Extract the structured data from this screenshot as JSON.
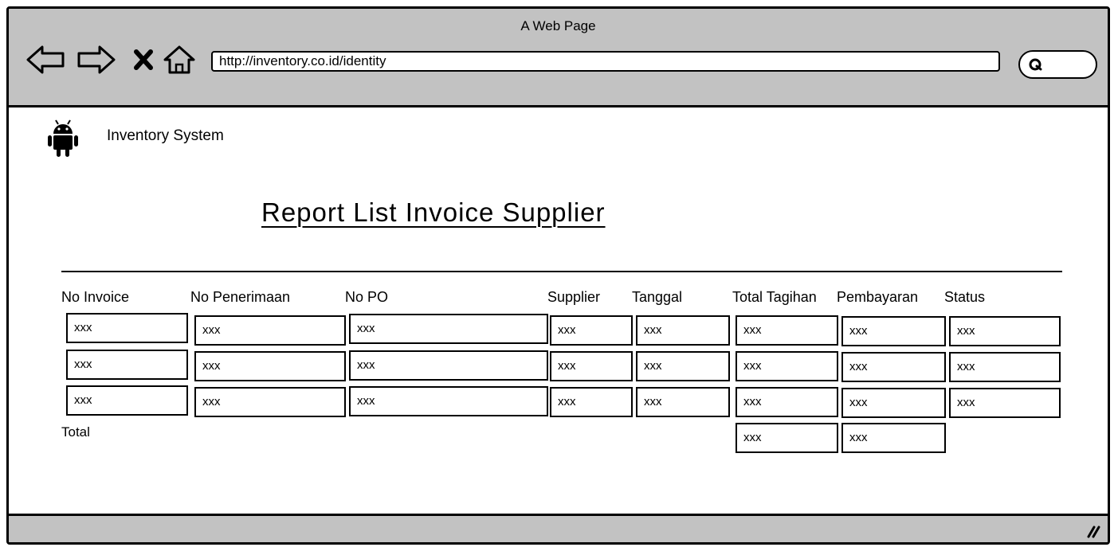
{
  "browser": {
    "window_title": "A Web Page",
    "url": "http://inventory.co.id/identity"
  },
  "app": {
    "name": "Inventory System",
    "logo_icon": "android-icon"
  },
  "report": {
    "title": "Report List Invoice Supplier",
    "columns": [
      "No Invoice",
      "No Penerimaan",
      "No PO",
      "Supplier",
      "Tanggal",
      "Total Tagihan",
      "Pembayaran",
      "Status"
    ],
    "rows": [
      [
        "xxx",
        "xxx",
        "xxx",
        "xxx",
        "xxx",
        "xxx",
        "xxx",
        "xxx"
      ],
      [
        "xxx",
        "xxx",
        "xxx",
        "xxx",
        "xxx",
        "xxx",
        "xxx",
        "xxx"
      ],
      [
        "xxx",
        "xxx",
        "xxx",
        "xxx",
        "xxx",
        "xxx",
        "xxx",
        "xxx"
      ]
    ],
    "total_label": "Total",
    "totals": {
      "total_tagihan": "xxx",
      "pembayaran": "xxx"
    }
  }
}
